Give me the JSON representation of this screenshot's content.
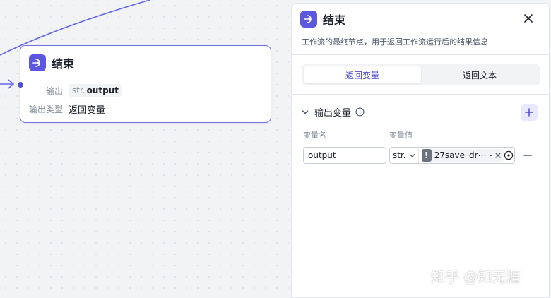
{
  "node": {
    "title": "结束",
    "output_label": "输出",
    "output_var_type": "str.",
    "output_var_name": "output",
    "output_type_label": "输出类型",
    "output_type_value": "返回变量"
  },
  "panel": {
    "title": "结束",
    "description": "工作流的最终节点，用于返回工作流运行后的结果信息",
    "tabs": [
      {
        "label": "返回变量",
        "active": true
      },
      {
        "label": "返回文本",
        "active": false
      }
    ],
    "section_title": "输出变量",
    "columns": {
      "name": "变量名",
      "value": "变量值"
    },
    "rows": [
      {
        "name": "output",
        "type": "str.",
        "ref": "27save_dr⋯",
        "sep": "-"
      }
    ]
  },
  "icons": {
    "node_icon": "end-node-icon",
    "close": "close-icon",
    "collapse": "chevron-down-icon",
    "info": "info-icon",
    "add": "plus-icon",
    "remove": "minus-icon",
    "target": "target-icon",
    "warning": "warning-icon"
  },
  "colors": {
    "accent": "#5b57e0",
    "border": "#6f6ee6",
    "tab_active": "#4e4bd6"
  },
  "watermark": "知乎 @知无涯"
}
